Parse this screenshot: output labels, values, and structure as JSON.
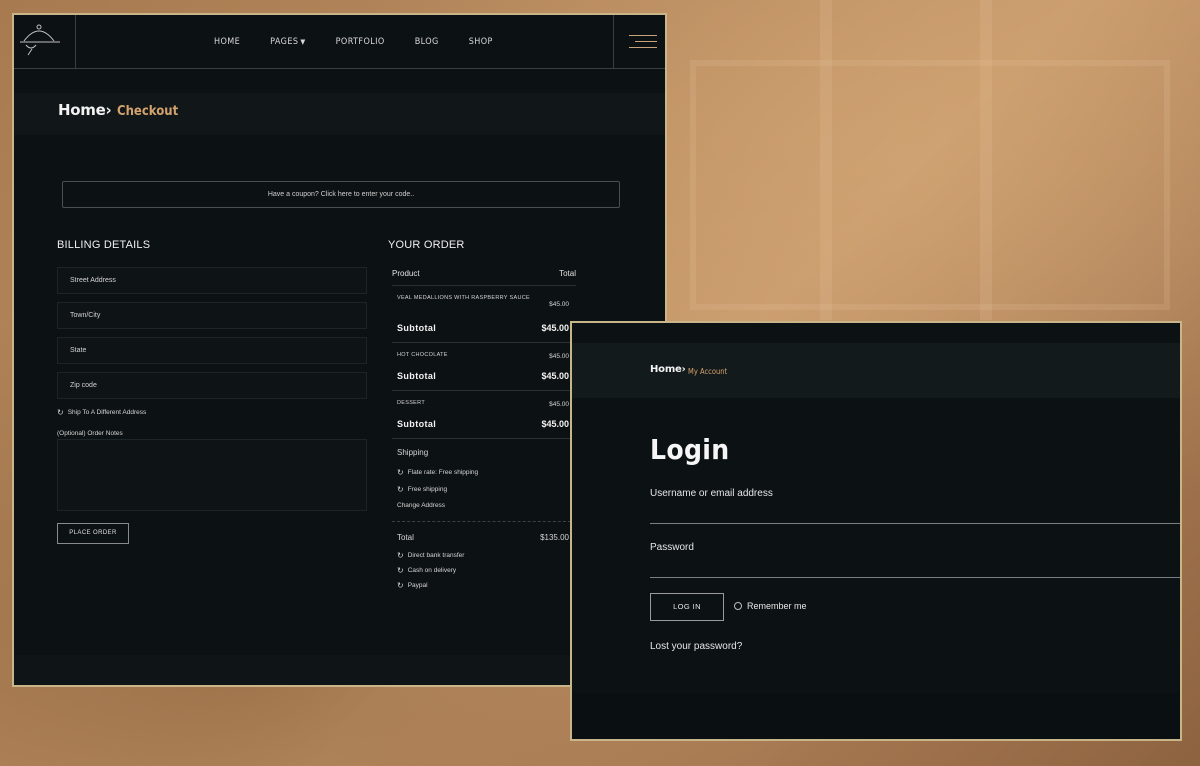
{
  "checkout": {
    "nav": {
      "items": [
        {
          "label": "HOME"
        },
        {
          "label": "PAGES"
        },
        {
          "label": "PORTFOLIO"
        },
        {
          "label": "BLOG"
        },
        {
          "label": "SHOP"
        }
      ],
      "logo_icon": "cloche-icon",
      "menu_icon": "hamburger-icon"
    },
    "breadcrumb": {
      "home": "Home",
      "current": "Checkout"
    },
    "coupon_text": "Have a coupon? Click here to enter your code..",
    "billing": {
      "title": "BILLING DETAILS",
      "fields": [
        {
          "placeholder": "Street Address"
        },
        {
          "placeholder": "Town/City"
        },
        {
          "placeholder": "State"
        },
        {
          "placeholder": "Zip code"
        }
      ],
      "ship_different": "Ship To A Different Address",
      "notes_label": "(Optional) Order Notes",
      "place_order": "PLACE ORDER"
    },
    "order": {
      "title": "YOUR ORDER",
      "col_product": "Product",
      "col_total": "Total",
      "items": [
        {
          "name": "VEAL MEDALLIONS WITH RASPBERRY SAUCE",
          "price": "$45.00",
          "subtotal_label": "Subtotal",
          "subtotal": "$45.00"
        },
        {
          "name": "HOT CHOCOLATE",
          "price": "$45.00",
          "subtotal_label": "Subtotal",
          "subtotal": "$45.00"
        },
        {
          "name": "DESSERT",
          "price": "$45.00",
          "subtotal_label": "Subtotal",
          "subtotal": "$45.00"
        }
      ],
      "shipping": {
        "label": "Shipping",
        "options": [
          "Flate rate: Free shipping",
          "Free shipping"
        ],
        "change_address": "Change Address"
      },
      "total_label": "Total",
      "total_value": "$135.00",
      "payment_options": [
        "Direct bank transfer",
        "Cash on delivery",
        "Paypal"
      ]
    }
  },
  "login": {
    "breadcrumb": {
      "home": "Home",
      "current": "My Account"
    },
    "title": "Login",
    "username_label": "Username or email address",
    "password_label": "Password",
    "login_button": "LOG IN",
    "remember_me": "Remember me",
    "lost_password": "Lost your password?"
  },
  "colors": {
    "accent": "#d4a26d",
    "panel_bg": "#0c1113",
    "panel_border": "#c8b58a"
  }
}
